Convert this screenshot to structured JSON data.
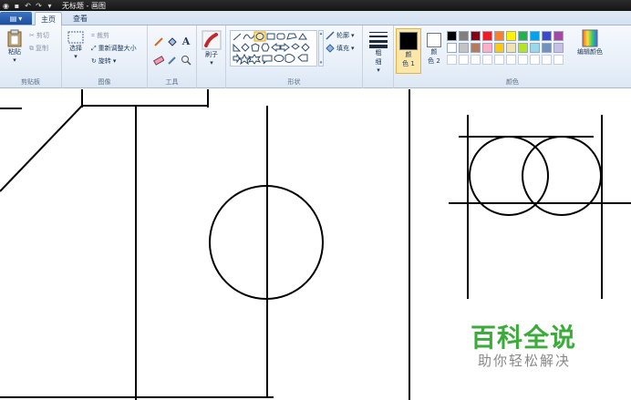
{
  "window": {
    "title": "无标题 - 画图"
  },
  "tabs": {
    "file_label": "",
    "home": "主页",
    "view": "查看"
  },
  "clipboard": {
    "paste": "粘贴",
    "cut": "剪切",
    "copy": "复制",
    "group_label": "剪贴板"
  },
  "image": {
    "select": "选择",
    "crop": "裁剪",
    "resize": "重新调整大小",
    "rotate": "旋转",
    "group_label": "图像"
  },
  "tools": {
    "group_label": "工具"
  },
  "brushes": {
    "label": "刷子"
  },
  "shapes": {
    "outline": "轮廓",
    "fill": "填充",
    "group_label": "形状"
  },
  "size": {
    "label_line1": "粗",
    "label_line2": "细"
  },
  "colors": {
    "color1_line1": "颜",
    "color1_line2": "色 1",
    "color2_line1": "颜",
    "color2_line2": "色 2",
    "edit_colors": "编辑颜色",
    "group_label": "颜色",
    "color1_value": "#000000",
    "color2_value": "#ffffff",
    "palette_row1": [
      "#000000",
      "#7f7f7f",
      "#880015",
      "#ed1c24",
      "#ff7f27",
      "#fff200",
      "#22b14c",
      "#00a2e8",
      "#3f48cc",
      "#a349a4"
    ],
    "palette_row2": [
      "#ffffff",
      "#c3c3c3",
      "#b97a57",
      "#ffaec9",
      "#ffc90e",
      "#efe4b0",
      "#b5e61d",
      "#99d9ea",
      "#7092be",
      "#c8bfe7"
    ]
  },
  "watermark": {
    "title": "百科全说",
    "subtitle": "助你轻松解决"
  }
}
